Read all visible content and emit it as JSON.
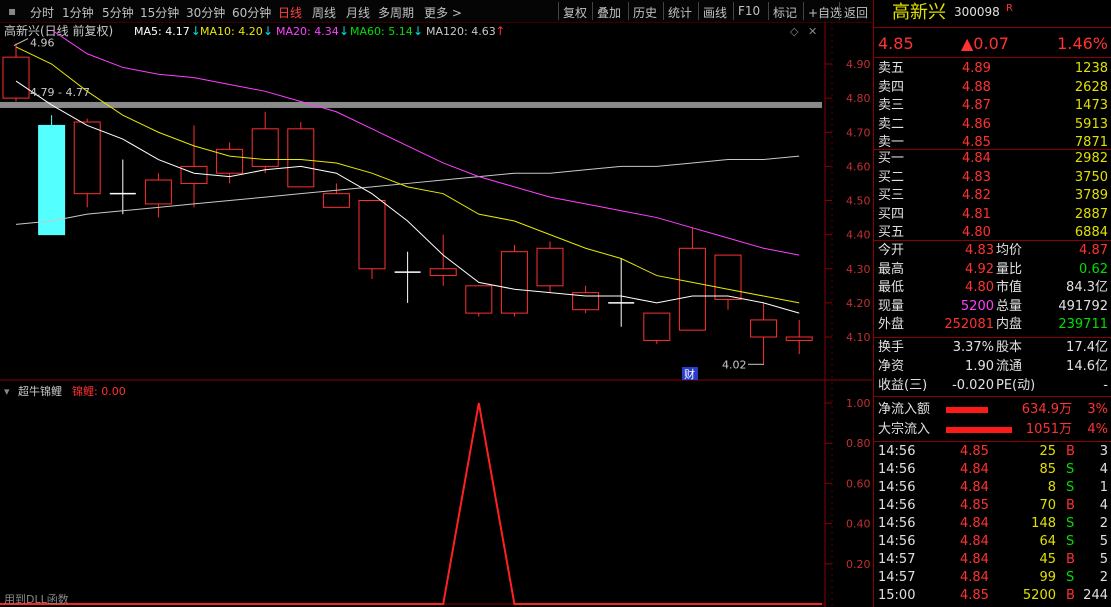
{
  "toolbar": {
    "periods": [
      "分时",
      "1分钟",
      "5分钟",
      "15分钟",
      "30分钟",
      "60分钟",
      "日线",
      "周线",
      "月线",
      "多周期",
      "更多 >"
    ],
    "active_period": "日线",
    "actions": [
      "复权",
      "叠加",
      "历史",
      "统计",
      "画线",
      "F10",
      "标记",
      "+自选",
      "返回"
    ]
  },
  "main_chart": {
    "title": "高新兴(日线 前复权)",
    "ma_labels": [
      {
        "text": "MA5: 4.17",
        "arrow": "↓",
        "color": "#ffffff"
      },
      {
        "text": "MA10: 4.20",
        "arrow": "↓",
        "color": "#e8e800"
      },
      {
        "text": "MA20: 4.34",
        "arrow": "↓",
        "color": "#ff40ff"
      },
      {
        "text": "MA60: 5.14",
        "arrow": "↓",
        "color": "#00e000"
      },
      {
        "text": "MA120: 4.63",
        "arrow": "↑",
        "color": "#c8c8c8"
      }
    ],
    "y_ticks": [
      "4.90",
      "4.80",
      "4.70",
      "4.60",
      "4.50",
      "4.40",
      "4.30",
      "4.20",
      "4.10"
    ],
    "annot_high": "4.96",
    "annot_range": "4.79 - 4.77",
    "annot_low": "4.02",
    "marker": "财",
    "candles": [
      {
        "o": 4.8,
        "c": 4.92,
        "h": 4.96,
        "l": 4.79
      },
      {
        "o": 4.72,
        "c": 4.4,
        "h": 4.75,
        "l": 4.4
      },
      {
        "o": 4.52,
        "c": 4.73,
        "h": 4.74,
        "l": 4.48
      },
      {
        "o": 4.52,
        "c": 4.52,
        "h": 4.62,
        "l": 4.46
      },
      {
        "o": 4.49,
        "c": 4.56,
        "h": 4.58,
        "l": 4.45
      },
      {
        "o": 4.55,
        "c": 4.6,
        "h": 4.72,
        "l": 4.48
      },
      {
        "o": 4.58,
        "c": 4.65,
        "h": 4.67,
        "l": 4.55
      },
      {
        "o": 4.6,
        "c": 4.71,
        "h": 4.76,
        "l": 4.58
      },
      {
        "o": 4.54,
        "c": 4.71,
        "h": 4.73,
        "l": 4.54
      },
      {
        "o": 4.48,
        "c": 4.52,
        "h": 4.55,
        "l": 4.48
      },
      {
        "o": 4.3,
        "c": 4.5,
        "h": 4.5,
        "l": 4.27
      },
      {
        "o": 4.29,
        "c": 4.29,
        "h": 4.35,
        "l": 4.2
      },
      {
        "o": 4.28,
        "c": 4.3,
        "h": 4.4,
        "l": 4.25
      },
      {
        "o": 4.17,
        "c": 4.25,
        "h": 4.25,
        "l": 4.16
      },
      {
        "o": 4.17,
        "c": 4.35,
        "h": 4.37,
        "l": 4.16
      },
      {
        "o": 4.25,
        "c": 4.36,
        "h": 4.38,
        "l": 4.23
      },
      {
        "o": 4.18,
        "c": 4.23,
        "h": 4.25,
        "l": 4.17
      },
      {
        "o": 4.2,
        "c": 4.2,
        "h": 4.33,
        "l": 4.13
      },
      {
        "o": 4.09,
        "c": 4.17,
        "h": 4.17,
        "l": 4.08
      },
      {
        "o": 4.12,
        "c": 4.36,
        "h": 4.42,
        "l": 4.12
      },
      {
        "o": 4.21,
        "c": 4.34,
        "h": 4.34,
        "l": 4.18
      },
      {
        "o": 4.1,
        "c": 4.15,
        "h": 4.2,
        "l": 4.02
      },
      {
        "o": 4.09,
        "c": 4.1,
        "h": 4.15,
        "l": 4.05
      }
    ],
    "ma5": [
      4.85,
      4.78,
      4.72,
      4.68,
      4.62,
      4.58,
      4.57,
      4.59,
      4.6,
      4.58,
      4.52,
      4.44,
      4.34,
      4.26,
      4.24,
      4.23,
      4.22,
      4.22,
      4.2,
      4.22,
      4.22,
      4.2,
      4.17
    ],
    "ma10": [
      4.95,
      4.9,
      4.82,
      4.75,
      4.7,
      4.66,
      4.63,
      4.62,
      4.62,
      4.61,
      4.58,
      4.54,
      4.52,
      4.46,
      4.44,
      4.4,
      4.36,
      4.33,
      4.28,
      4.26,
      4.24,
      4.22,
      4.2
    ],
    "ma20": [
      5.05,
      5.0,
      4.93,
      4.89,
      4.87,
      4.86,
      4.84,
      4.82,
      4.79,
      4.76,
      4.71,
      4.66,
      4.61,
      4.57,
      4.54,
      4.51,
      4.49,
      4.47,
      4.45,
      4.42,
      4.39,
      4.36,
      4.34
    ],
    "ma120": [
      4.43,
      4.44,
      4.46,
      4.47,
      4.48,
      4.49,
      4.5,
      4.51,
      4.52,
      4.53,
      4.54,
      4.55,
      4.56,
      4.57,
      4.58,
      4.58,
      4.59,
      4.6,
      4.6,
      4.61,
      4.62,
      4.62,
      4.63
    ],
    "resistance": 4.78
  },
  "sub_chart": {
    "title": "超牛锦鲤",
    "value_label": "锦鲤: 0.00",
    "y_ticks": [
      "1.00",
      "0.80",
      "0.60",
      "0.40",
      "0.20"
    ],
    "line_values": [
      0,
      0,
      0,
      0,
      0,
      0,
      0,
      0,
      0,
      0,
      0,
      0,
      0,
      1,
      0,
      0,
      0,
      0,
      0,
      0,
      0,
      0,
      0
    ]
  },
  "footer_text": "用到DLL函数",
  "quote": {
    "name": "高新兴",
    "code": "300098",
    "badge": "R",
    "price": "4.85",
    "change": "▲0.07",
    "pct": "1.46%",
    "asks": [
      {
        "label": "卖五",
        "price": "4.89",
        "vol": "1238"
      },
      {
        "label": "卖四",
        "price": "4.88",
        "vol": "2628"
      },
      {
        "label": "卖三",
        "price": "4.87",
        "vol": "1473"
      },
      {
        "label": "卖二",
        "price": "4.86",
        "vol": "5913"
      },
      {
        "label": "卖一",
        "price": "4.85",
        "vol": "7871"
      }
    ],
    "bids": [
      {
        "label": "买一",
        "price": "4.84",
        "vol": "2982"
      },
      {
        "label": "买二",
        "price": "4.83",
        "vol": "3750"
      },
      {
        "label": "买三",
        "price": "4.82",
        "vol": "3789"
      },
      {
        "label": "买四",
        "price": "4.81",
        "vol": "2887"
      },
      {
        "label": "买五",
        "price": "4.80",
        "vol": "6884"
      }
    ],
    "stats": [
      {
        "l1": "今开",
        "v1": "4.83",
        "c1": "red",
        "l2": "均价",
        "v2": "4.87",
        "c2": "red"
      },
      {
        "l1": "最高",
        "v1": "4.92",
        "c1": "red",
        "l2": "量比",
        "v2": "0.62",
        "c2": "green"
      },
      {
        "l1": "最低",
        "v1": "4.80",
        "c1": "red",
        "l2": "市值",
        "v2": "84.3亿",
        "c2": "white"
      },
      {
        "l1": "现量",
        "v1": "5200",
        "c1": "magenta",
        "l2": "总量",
        "v2": "491792",
        "c2": "white"
      },
      {
        "l1": "外盘",
        "v1": "252081",
        "c1": "red",
        "l2": "内盘",
        "v2": "239711",
        "c2": "green"
      }
    ],
    "fund": [
      {
        "l1": "换手",
        "v1": "3.37%",
        "l2": "股本",
        "v2": "17.4亿"
      },
      {
        "l1": "净资",
        "v1": "1.90",
        "l2": "流通",
        "v2": "14.6亿"
      },
      {
        "l1": "收益(三)",
        "v1": "-0.020",
        "l2": "PE(动)",
        "v2": "-"
      }
    ],
    "flows": [
      {
        "label": "净流入额",
        "value": "634.9万",
        "pct": "3%",
        "bar": 0.35
      },
      {
        "label": "大宗流入",
        "value": "1051万",
        "pct": "4%",
        "bar": 0.55
      }
    ],
    "ticks": [
      {
        "t": "14:56",
        "p": "4.85",
        "v": "25",
        "s": "B",
        "n": "3"
      },
      {
        "t": "14:56",
        "p": "4.84",
        "v": "85",
        "s": "S",
        "n": "4"
      },
      {
        "t": "14:56",
        "p": "4.84",
        "v": "8",
        "s": "S",
        "n": "1"
      },
      {
        "t": "14:56",
        "p": "4.85",
        "v": "70",
        "s": "B",
        "n": "4"
      },
      {
        "t": "14:56",
        "p": "4.84",
        "v": "148",
        "s": "S",
        "n": "2"
      },
      {
        "t": "14:56",
        "p": "4.84",
        "v": "64",
        "s": "S",
        "n": "5"
      },
      {
        "t": "14:57",
        "p": "4.84",
        "v": "45",
        "s": "B",
        "n": "5"
      },
      {
        "t": "14:57",
        "p": "4.84",
        "v": "99",
        "s": "S",
        "n": "2"
      },
      {
        "t": "15:00",
        "p": "4.85",
        "v": "5200",
        "s": "B",
        "n": "244"
      }
    ]
  }
}
